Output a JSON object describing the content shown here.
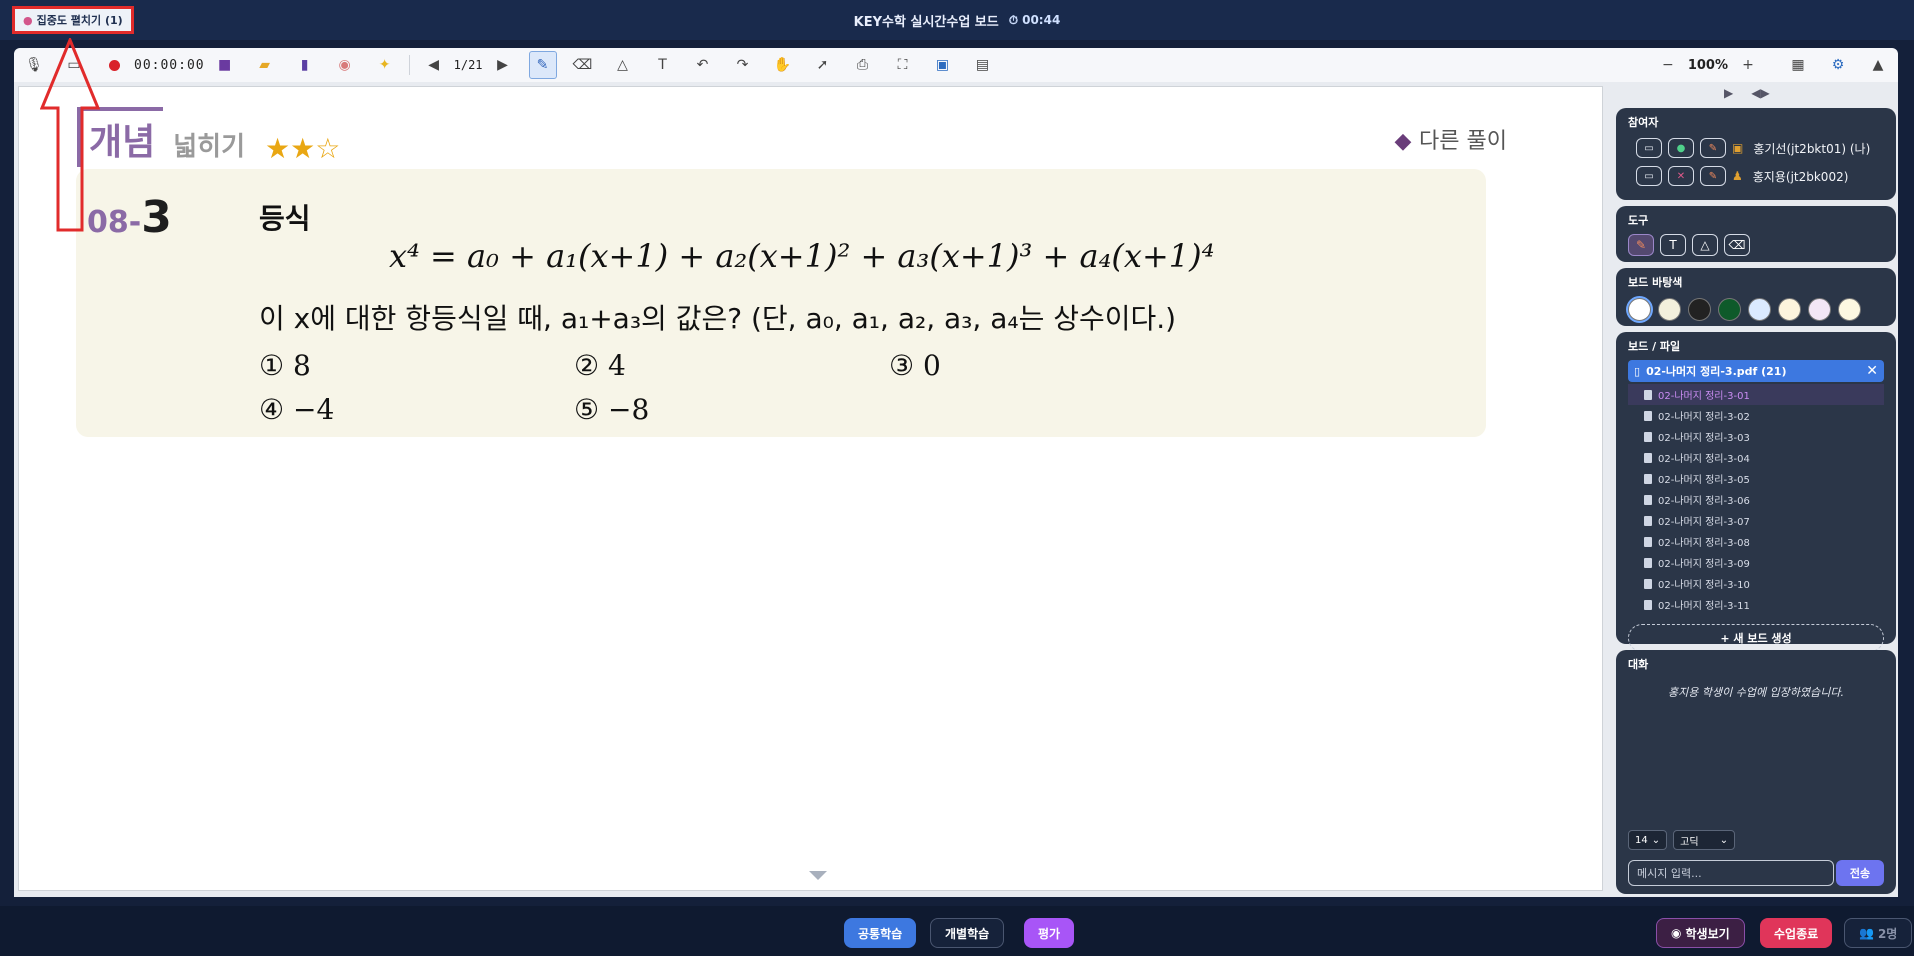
{
  "app": {
    "title": "KEY수학 실시간수업 보드",
    "timer": "00:44",
    "focus_badge": "집중도 펼치기 (1)"
  },
  "toolbar": {
    "rec_time": "00:00:00",
    "page": "1/21",
    "text_tool": "T",
    "zoom_minus": "−",
    "zoom": "100%",
    "zoom_plus": "+"
  },
  "board": {
    "concept_label": "개념",
    "concept_sub": "넓히기",
    "stars": "★★☆",
    "alt_solution": "다른 풀이",
    "problem": {
      "number_prefix": "08-",
      "number_main": "3",
      "title": "등식",
      "equation": "x⁴ = a₀ + a₁(x+1) + a₂(x+1)² + a₃(x+1)³ + a₄(x+1)⁴",
      "question": "이 x에 대한 항등식일 때, a₁+a₃의 값은? (단, a₀, a₁, a₂, a₃, a₄는 상수이다.)",
      "choices": [
        "① 8",
        "② 4",
        "③ 0",
        "④ −4",
        "⑤ −8"
      ]
    }
  },
  "sidebar": {
    "participants_title": "참여자",
    "participants": [
      {
        "name": "홍기선(jt2bkt01) (나)"
      },
      {
        "name": "홍지용(jt2bk002)"
      }
    ],
    "tools_title": "도구",
    "bg_title": "보드 바탕색",
    "bg_colors": [
      "#ffffff",
      "#f3f0dc",
      "#222222",
      "#0e5a2a",
      "#dbeaff",
      "#fdf4dd",
      "#f3e6f6",
      "#fdf8e1"
    ],
    "files_title": "보드 / 파일",
    "file_name": "02-나머지 정리-3.pdf (21)",
    "file_items": [
      "02-나머지 정리-3-01",
      "02-나머지 정리-3-02",
      "02-나머지 정리-3-03",
      "02-나머지 정리-3-04",
      "02-나머지 정리-3-05",
      "02-나머지 정리-3-06",
      "02-나머지 정리-3-07",
      "02-나머지 정리-3-08",
      "02-나머지 정리-3-09",
      "02-나머지 정리-3-10",
      "02-나머지 정리-3-11"
    ],
    "new_board": "+ 새 보드 생성",
    "chat_title": "대화",
    "chat_message": "홍지용 학생이 수업에 입장하였습니다.",
    "font_size": "14",
    "font_face": "고딕",
    "chat_placeholder": "메시지 입력...",
    "send": "전송"
  },
  "bottom": {
    "common": "공통학습",
    "individual": "개별학습",
    "eval": "평가",
    "student_view": "학생보기",
    "end_class": "수업종료",
    "count": "2명"
  },
  "colors": {
    "accent": "#3d78e0",
    "concept": "#8b6aa6",
    "eval": "#a855f7",
    "end": "#e0355a"
  }
}
